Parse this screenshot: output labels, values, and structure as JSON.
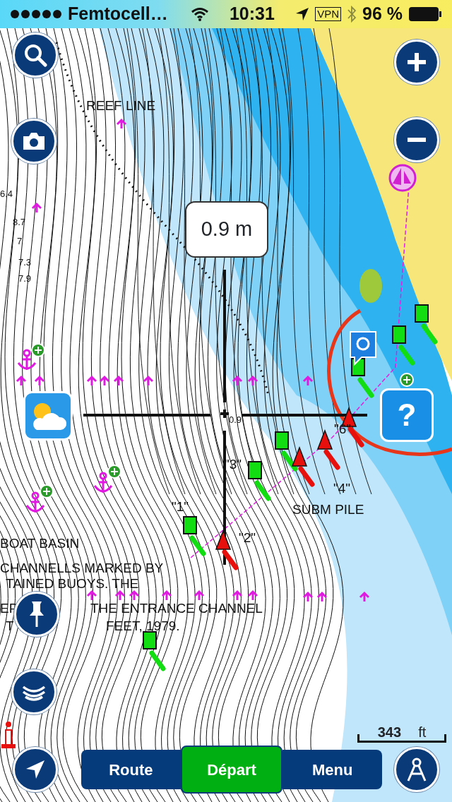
{
  "status_bar": {
    "carrier": "Femtocell…",
    "time": "10:31",
    "vpn": "VPN",
    "battery": "96 %"
  },
  "depth_callout": "0.9 m",
  "map_labels": [
    {
      "text": "REEF LINE",
      "kind": "note"
    },
    {
      "text": "6.4",
      "kind": "sounding"
    },
    {
      "text": "8.7",
      "kind": "sounding"
    },
    {
      "text": "7",
      "kind": "sounding"
    },
    {
      "text": "7.3",
      "kind": "sounding"
    },
    {
      "text": "7.9",
      "kind": "sounding"
    },
    {
      "text": "0.9",
      "kind": "sounding"
    },
    {
      "text": "\"6\"",
      "kind": "buoy"
    },
    {
      "text": "\"3\"",
      "kind": "buoy"
    },
    {
      "text": "\"4\"",
      "kind": "buoy"
    },
    {
      "text": "\"1\"",
      "kind": "buoy"
    },
    {
      "text": "SUBM PILE",
      "kind": "note"
    },
    {
      "text": "\"2\"",
      "kind": "buoy"
    },
    {
      "text": "BOAT BASIN",
      "kind": "note"
    },
    {
      "text": "CHANNELLS MARKED BY",
      "kind": "note"
    },
    {
      "text": "TAINED BUOYS. THE",
      "kind": "note"
    },
    {
      "text": "EP",
      "kind": "note"
    },
    {
      "text": "THE ENTRANCE CHANNEL",
      "kind": "note"
    },
    {
      "text": "T",
      "kind": "note"
    },
    {
      "text": "FEET, 1979.",
      "kind": "note"
    }
  ],
  "help_button": "?",
  "scale": {
    "value": "343",
    "unit": "ft"
  },
  "tabs": [
    {
      "label": "Route",
      "selected": false
    },
    {
      "label": "Départ",
      "selected": true
    },
    {
      "label": "Menu",
      "selected": false
    }
  ]
}
